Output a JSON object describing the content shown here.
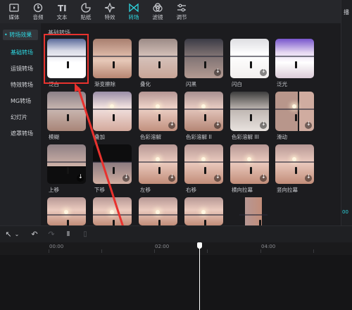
{
  "toolbar": {
    "tabs": [
      {
        "label": "媒体",
        "icon": "media-icon"
      },
      {
        "label": "音频",
        "icon": "audio-icon"
      },
      {
        "label": "文本",
        "icon": "text-icon"
      },
      {
        "label": "贴纸",
        "icon": "sticker-icon"
      },
      {
        "label": "特效",
        "icon": "effects-icon"
      },
      {
        "label": "转场",
        "icon": "transition-icon",
        "active": true
      },
      {
        "label": "滤镜",
        "icon": "filter-icon"
      },
      {
        "label": "调节",
        "icon": "adjust-icon"
      }
    ]
  },
  "right_panel": {
    "label": "播",
    "time": "00"
  },
  "sidebar": {
    "header": "• 转场效果",
    "items": [
      {
        "label": "基础转场",
        "active": true
      },
      {
        "label": "运镜转场"
      },
      {
        "label": "特效转场"
      },
      {
        "label": "MG转场"
      },
      {
        "label": "幻灯片"
      },
      {
        "label": "遮罩转场"
      }
    ]
  },
  "section_title": "基础转场",
  "tiles": [
    {
      "label": "泛白"
    },
    {
      "label": "渐变擦除"
    },
    {
      "label": "叠化"
    },
    {
      "label": "闪黑"
    },
    {
      "label": "闪白"
    },
    {
      "label": "泛光"
    },
    {
      "label": "模糊"
    },
    {
      "label": "叠加"
    },
    {
      "label": "色彩溶解"
    },
    {
      "label": "色彩溶解 II"
    },
    {
      "label": "色彩溶解 III"
    },
    {
      "label": "滑动"
    },
    {
      "label": "上移"
    },
    {
      "label": "下移"
    },
    {
      "label": "左移"
    },
    {
      "label": "右移"
    },
    {
      "label": "横向拉幕"
    },
    {
      "label": "竖向拉幕"
    },
    {
      "label": ""
    },
    {
      "label": ""
    },
    {
      "label": ""
    },
    {
      "label": ""
    },
    {
      "label": ""
    }
  ],
  "timeline": {
    "ticks": [
      "00:00",
      "02:00",
      "04:00"
    ]
  },
  "colors": {
    "accent": "#2ed6e0",
    "highlight": "#e8322e"
  }
}
